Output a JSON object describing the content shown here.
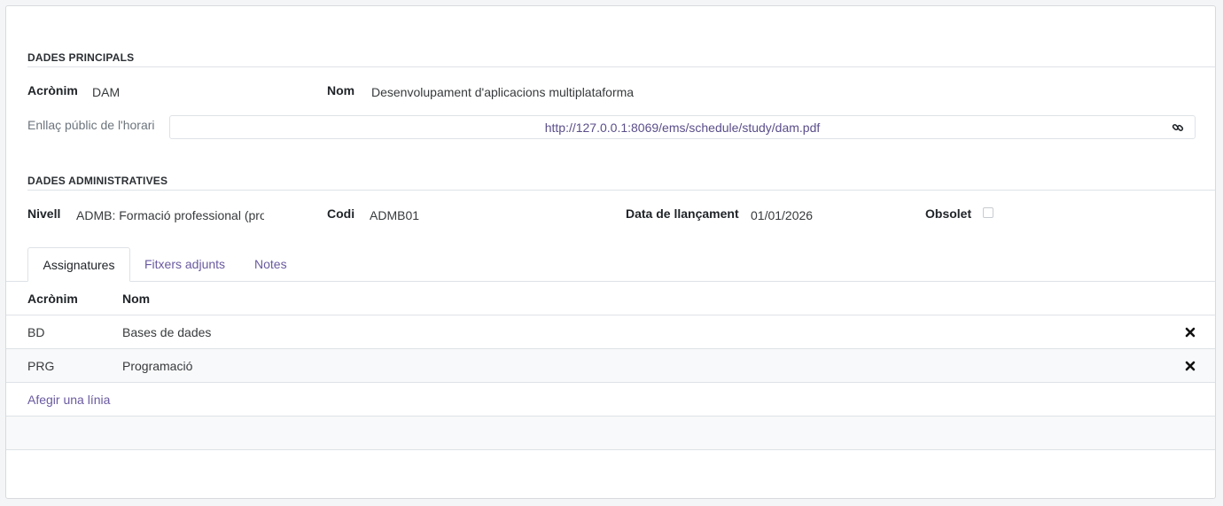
{
  "sections": {
    "principal": "DADES PRINCIPALS",
    "administrative": "DADES ADMINISTRATIVES"
  },
  "fields": {
    "acronym_label": "Acrònim",
    "acronym_value": "DAM",
    "name_label": "Nom",
    "name_value": "Desenvolupament d'aplicacions multiplataforma",
    "schedule_link_label": "Enllaç públic de l'horari",
    "schedule_link_value": "http://127.0.0.1:8069/ems/schedule/study/dam.pdf",
    "level_label": "Nivell",
    "level_value": "ADMB: Formació professional (pro",
    "code_label": "Codi",
    "code_value": "ADMB01",
    "launch_date_label": "Data de llançament",
    "launch_date_value": "01/01/2026",
    "obsolete_label": "Obsolet",
    "obsolete_checked": false
  },
  "tabs": [
    {
      "label": "Assignatures",
      "active": true
    },
    {
      "label": "Fitxers adjunts",
      "active": false
    },
    {
      "label": "Notes",
      "active": false
    }
  ],
  "table": {
    "columns": [
      "Acrònim",
      "Nom"
    ],
    "rows": [
      {
        "acronym": "BD",
        "name": "Bases de dades"
      },
      {
        "acronym": "PRG",
        "name": "Programació"
      }
    ],
    "add_line_label": "Afegir una línia"
  },
  "icons": {
    "link": "link-icon",
    "delete": "close-icon"
  },
  "colors": {
    "link": "#6a5aa0",
    "url": "#5b4e8a",
    "border": "#dee2e6"
  }
}
